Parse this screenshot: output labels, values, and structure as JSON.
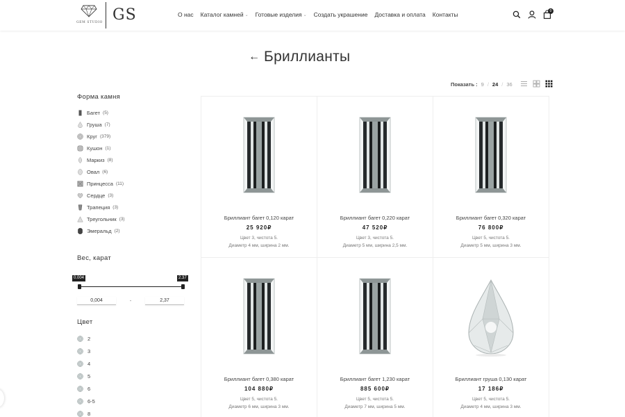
{
  "brand": {
    "studio": "GEM STUDIO",
    "monogram": "GS"
  },
  "nav": [
    {
      "label": "О нас",
      "dropdown": false
    },
    {
      "label": "Каталог камней",
      "dropdown": true
    },
    {
      "label": "Готовые изделия",
      "dropdown": true
    },
    {
      "label": "Создать украшение",
      "dropdown": false
    },
    {
      "label": "Доставка и оплата",
      "dropdown": false
    },
    {
      "label": "Контакты",
      "dropdown": false
    }
  ],
  "header_icons": [
    "search-icon",
    "user-icon",
    "cart-icon"
  ],
  "cart_count": "0",
  "page_title": "Бриллианты",
  "show": {
    "label": "Показать :",
    "options": [
      "9",
      "24",
      "36"
    ],
    "active": "24"
  },
  "view_modes": [
    "list-view-icon",
    "grid-2-icon",
    "grid-3-icon"
  ],
  "sidebar": {
    "shape_title": "Форма камня",
    "shapes": [
      {
        "label": "Багет",
        "count": "(5)",
        "icon": "baguette"
      },
      {
        "label": "Груша",
        "count": "(7)",
        "icon": "pear"
      },
      {
        "label": "Круг",
        "count": "(379)",
        "icon": "round"
      },
      {
        "label": "Кушон",
        "count": "(1)",
        "icon": "cushion"
      },
      {
        "label": "Маркиз",
        "count": "(8)",
        "icon": "marquise"
      },
      {
        "label": "Овал",
        "count": "(6)",
        "icon": "oval"
      },
      {
        "label": "Принцесса",
        "count": "(11)",
        "icon": "princess"
      },
      {
        "label": "Сердце",
        "count": "(3)",
        "icon": "heart"
      },
      {
        "label": "Трапеция",
        "count": "(3)",
        "icon": "trapeze"
      },
      {
        "label": "Треугольник",
        "count": "(3)",
        "icon": "triangle"
      },
      {
        "label": "Эмеральд",
        "count": "(2)",
        "icon": "emerald"
      }
    ],
    "weight_title": "Вес, карат",
    "weight_min_tip": "0.004",
    "weight_max_tip": "2.37",
    "weight_min_value": "0,004",
    "weight_max_value": "2,37",
    "weight_dash": "-",
    "color_title": "Цвет",
    "colors": [
      "2",
      "3",
      "4",
      "5",
      "6",
      "6-5",
      "8"
    ]
  },
  "products": [
    {
      "name": "Бриллиант багет 0,120 карат",
      "price": "25 920₽",
      "d1": "Цвет 3, чистота 5.",
      "d2": "Диаметр 4 мм, ширина 2 мм.",
      "shape": "baguette"
    },
    {
      "name": "Бриллиант багет 0,220 карат",
      "price": "47 520₽",
      "d1": "Цвет 3, чистота 5.",
      "d2": "Диаметр 5 мм, ширина 2,5 мм.",
      "shape": "baguette"
    },
    {
      "name": "Бриллиант багет 0,320 карат",
      "price": "76 800₽",
      "d1": "Цвет 5, чистота 5.",
      "d2": "Диаметр 5 мм, ширина 3 мм.",
      "shape": "baguette"
    },
    {
      "name": "Бриллиант багет 0,380 карат",
      "price": "104 880₽",
      "d1": "Цвет 5, чистота 5.",
      "d2": "Диаметр 6 мм, ширина 3 мм.",
      "shape": "baguette"
    },
    {
      "name": "Бриллиант багет 1,230 карат",
      "price": "885 600₽",
      "d1": "Цвет 5, чистота 5.",
      "d2": "Диаметр 7 мм, ширина 5 мм.",
      "shape": "baguette"
    },
    {
      "name": "Бриллиант груша 0,130 карат",
      "price": "17 186₽",
      "d1": "Цвет 5, чистота 5.",
      "d2": "Диаметр 4 мм, ширина 3 мм.",
      "shape": "pear"
    }
  ]
}
